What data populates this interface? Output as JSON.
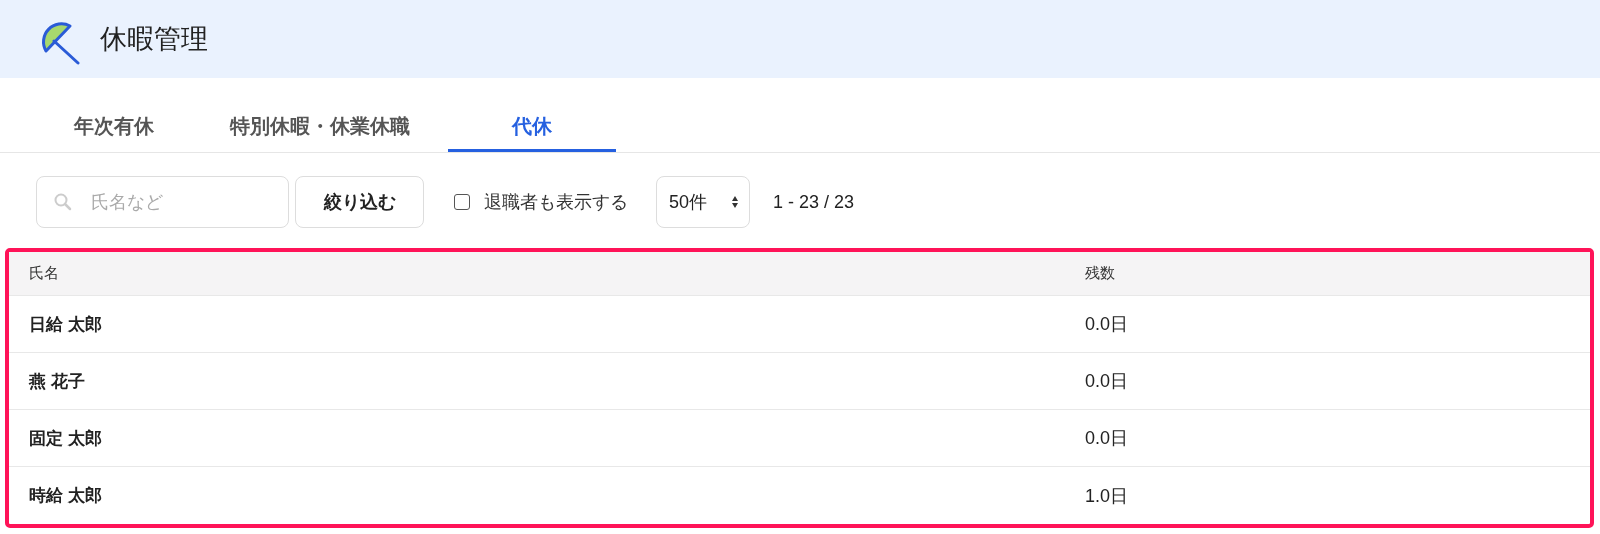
{
  "header": {
    "title": "休暇管理"
  },
  "tabs": [
    {
      "label": "年次有休",
      "selected": false
    },
    {
      "label": "特別休暇・休業休職",
      "selected": false
    },
    {
      "label": "代休",
      "selected": true
    }
  ],
  "toolbar": {
    "search": {
      "placeholder": "氏名など"
    },
    "filter_button": "絞り込む",
    "show_retired": {
      "label": "退職者も表示する",
      "checked": false
    },
    "page_size": "50件",
    "range": "1 - 23 / 23"
  },
  "table": {
    "highlighted": true,
    "columns": [
      "氏名",
      "残数"
    ],
    "rows": [
      [
        "日給 太郎",
        "0.0日"
      ],
      [
        "燕 花子",
        "0.0日"
      ],
      [
        "固定 太郎",
        "0.0日"
      ],
      [
        "時給 太郎",
        "1.0日"
      ]
    ]
  }
}
